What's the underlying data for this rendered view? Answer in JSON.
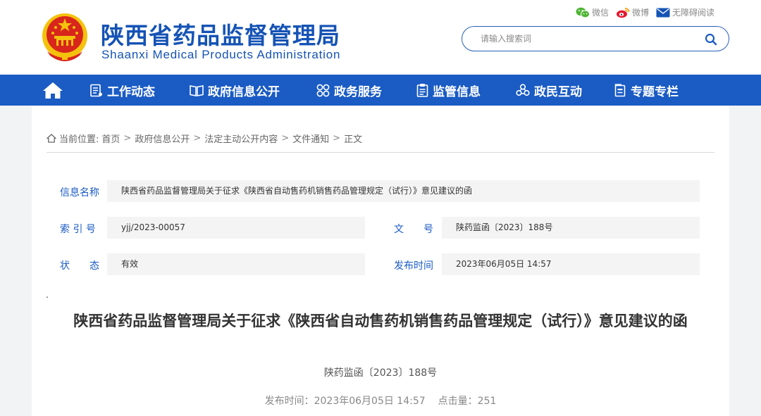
{
  "header": {
    "site_title": "陕西省药品监督管理局",
    "site_subtitle": "Shaanxi Medical Products Administration",
    "top_links": {
      "wechat": "微信",
      "weibo": "微博",
      "accessibility": "无障碍阅读"
    },
    "search": {
      "placeholder": "请输入搜索词"
    }
  },
  "nav": {
    "items": [
      {
        "label": "工作动态",
        "icon": "document-list-icon"
      },
      {
        "label": "政府信息公开",
        "icon": "open-book-icon"
      },
      {
        "label": "政务服务",
        "icon": "grid-circles-icon"
      },
      {
        "label": "监管信息",
        "icon": "clipboard-icon"
      },
      {
        "label": "政民互动",
        "icon": "interaction-icon"
      },
      {
        "label": "专题专栏",
        "icon": "folder-icon"
      }
    ]
  },
  "breadcrumb": {
    "prefix": "当前位置:",
    "items": [
      "首页",
      "政府信息公开",
      "法定主动公开内容",
      "文件通知",
      "正文"
    ],
    "separator": ">"
  },
  "meta": {
    "name_label": "信息名称",
    "name_value": "陕西省药品监督管理局关于征求《陕西省自动售药机销售药品管理规定（试行）》意见建议的函",
    "index_label": "索 引 号",
    "index_value": "yjj/2023-00057",
    "docno_label": "文　　号",
    "docno_value": "陕药监函〔2023〕188号",
    "status_label": "状　　态",
    "status_value": "有效",
    "date_label": "发布时间",
    "date_value": "2023年06月05日 14:57"
  },
  "article": {
    "stray_mark": ".",
    "title": "陕西省药品监督管理局关于征求《陕西省自动售药机销售药品管理规定（试行）》意见建议的函",
    "doc_number": "陕药监函〔2023〕188号",
    "publish_label": "发布时间：",
    "publish_time": "2023年06月05日 14:57",
    "hits_label": "点击量：",
    "hits_value": "251"
  },
  "colors": {
    "brand_blue": "#1a5bc4",
    "title_blue": "#1553b5",
    "emblem_red": "#d8261c",
    "emblem_gold": "#f4c20d"
  }
}
